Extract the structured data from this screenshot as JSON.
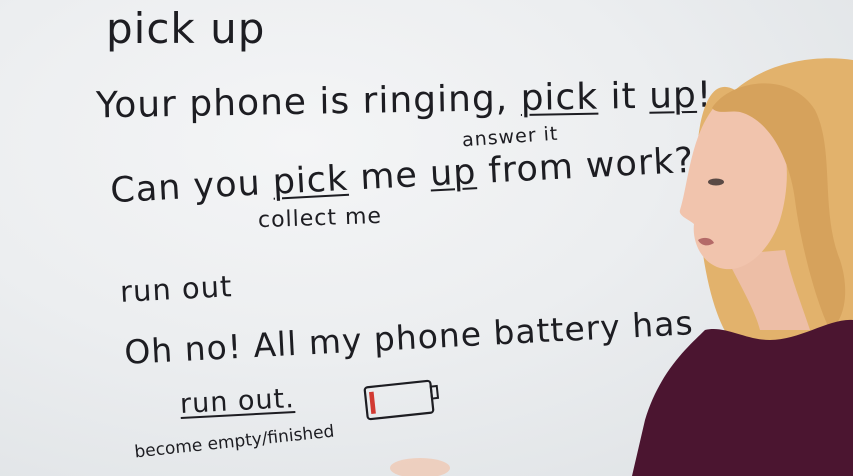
{
  "whiteboard": {
    "phrase1": {
      "heading": "pick up",
      "sentence1": {
        "before": "Your phone is ringing,",
        "pick": "pick",
        "it": "it",
        "up": "up",
        "after": "!",
        "gloss": "answer it"
      },
      "sentence2": {
        "before": "Can you",
        "pick": "pick",
        "me": "me",
        "up": "up",
        "after": "from work?",
        "gloss": "collect me"
      }
    },
    "phrase2": {
      "heading": "run out",
      "sentence": "Oh no! All my phone battery has",
      "underlined": "run out.",
      "gloss": "become empty/finished",
      "battery_level_fraction": 0.08
    }
  },
  "colors": {
    "ink": "#1d1d22",
    "battery_charge": "#d23a32",
    "sweater": "#4b1530",
    "hair": "#e2b26c",
    "skin": "#f1c4ad"
  }
}
